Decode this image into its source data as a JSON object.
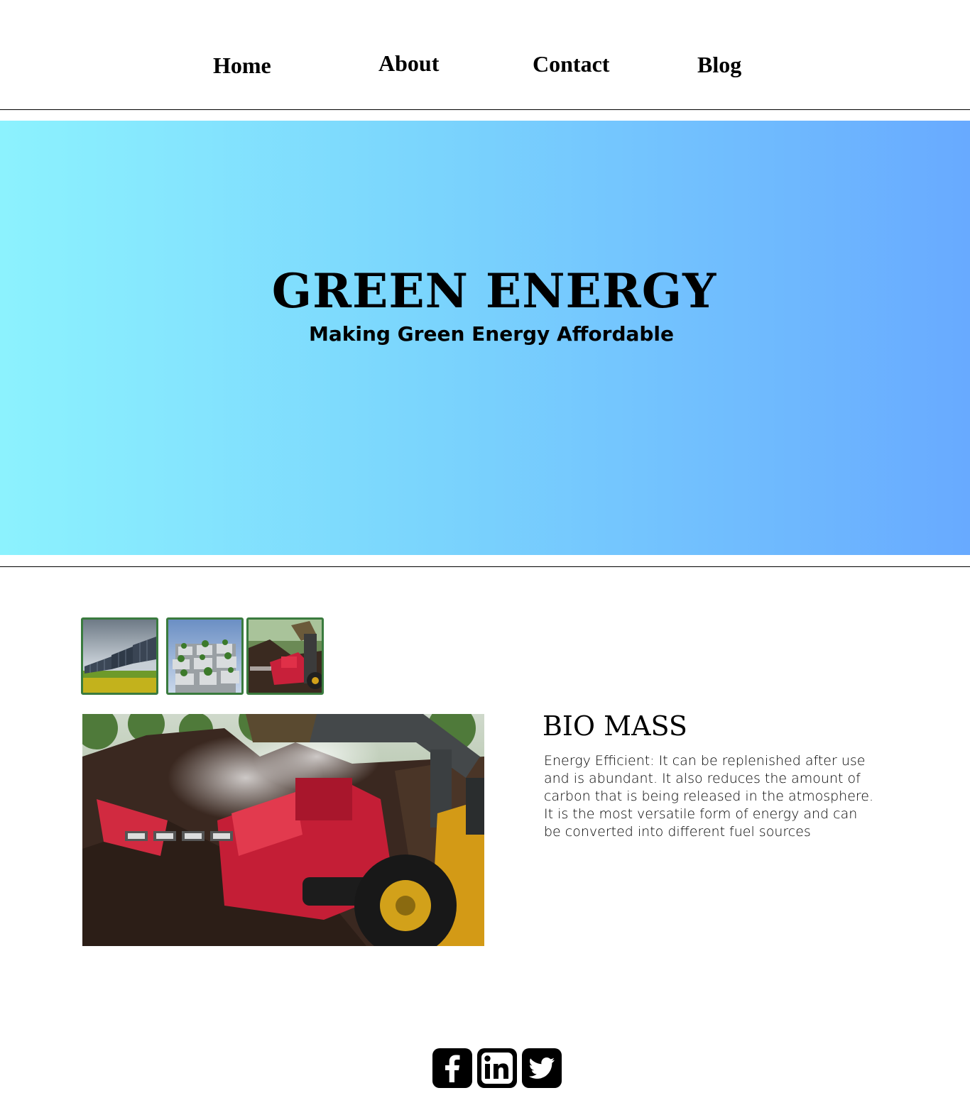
{
  "nav": {
    "items": [
      {
        "label": "Home"
      },
      {
        "label": "About"
      },
      {
        "label": "Contact"
      },
      {
        "label": "Blog"
      }
    ]
  },
  "hero": {
    "title": "GREEN ENERGY",
    "subtitle": "Making Green Energy Affordable",
    "gradient_start": "#8cf2fe",
    "gradient_end": "#68aaff"
  },
  "gallery": {
    "thumbnails": [
      {
        "icon": "solar-panels-image"
      },
      {
        "icon": "green-building-image"
      },
      {
        "icon": "biomass-machine-image"
      }
    ],
    "thumb_border_color": "#3a7b3e",
    "main_image": {
      "icon": "biomass-machine-image"
    }
  },
  "content": {
    "title": "BIO MASS",
    "body": "Energy Efficient: It can be replenished after use and is abundant. It also reduces the amount of carbon that is being released in the atmosphere. It is the most versatile form of energy and can be converted into different fuel sources"
  },
  "social": [
    {
      "icon": "facebook-icon"
    },
    {
      "icon": "linkedin-icon"
    },
    {
      "icon": "twitter-icon"
    }
  ]
}
